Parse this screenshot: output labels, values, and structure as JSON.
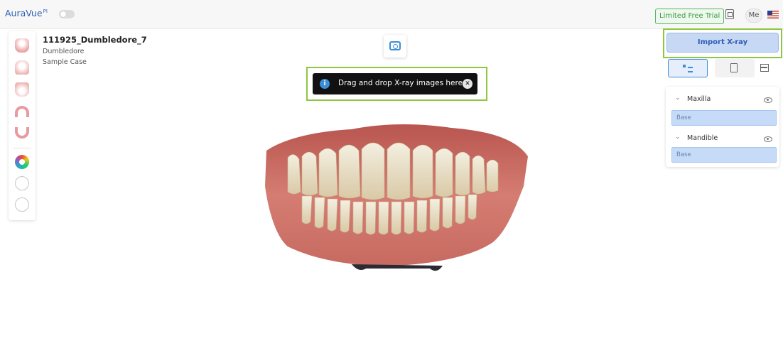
{
  "app": {
    "name": "AuraVue",
    "superscript": "PI"
  },
  "header": {
    "trial_label": "Limited Free Trial",
    "user_initials": "Me"
  },
  "case": {
    "title": "111925_Dumbledore_7",
    "patient": "Dumbledore",
    "subtitle": "Sample Case"
  },
  "toast": {
    "message": "Drag and drop X-ray images here",
    "info_glyph": "i",
    "close_glyph": "✕"
  },
  "right_panel": {
    "import_label": "Import X-ray",
    "tree": [
      {
        "label": "Maxilla",
        "child": "Base"
      },
      {
        "label": "Mandible",
        "child": "Base"
      }
    ]
  },
  "left_toolbar": {
    "tools": [
      "full-jaw-icon",
      "upper-jaw-icon",
      "lower-jaw-icon",
      "upper-arch-icon",
      "lower-arch-icon",
      "color-wheel-icon",
      "tooth-analysis-icon",
      "crown-check-icon"
    ]
  },
  "colors": {
    "accent": "#3c8fd6",
    "highlight_frame": "#8dc63f",
    "trial_green": "#3a9a3f"
  }
}
